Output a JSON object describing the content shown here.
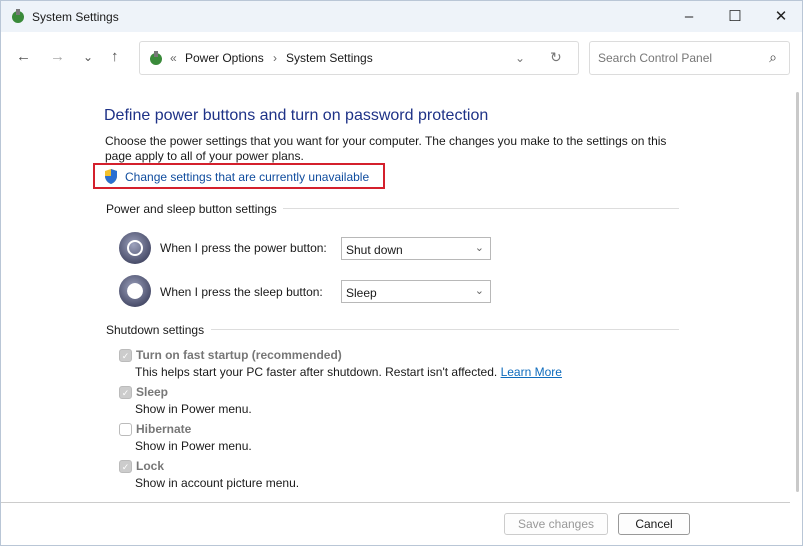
{
  "window": {
    "title": "System Settings",
    "minimize": "–",
    "maximize": "☐",
    "close": "✕"
  },
  "nav": {
    "back": "←",
    "forward": "→",
    "recent": "⌄",
    "up": "↑"
  },
  "address": {
    "prefix": "«",
    "crumbs": [
      "Power Options",
      "System Settings"
    ],
    "sep": "›",
    "dropdown": "⌄",
    "refresh": "↻"
  },
  "search": {
    "placeholder": "Search Control Panel",
    "icon": "⌕"
  },
  "page": {
    "heading": "Define power buttons and turn on password protection",
    "description": "Choose the power settings that you want for your computer. The changes you make to the settings on this page apply to all of your power plans.",
    "change_link": "Change settings that are currently unavailable",
    "power_section": "Power and sleep button settings",
    "power_label": "When I press the power button:",
    "power_value": "Shut down",
    "sleep_label": "When I press the sleep button:",
    "sleep_value": "Sleep",
    "shutdown_section": "Shutdown settings",
    "options": [
      {
        "label": "Turn on fast startup (recommended)",
        "desc": "This helps start your PC faster after shutdown. Restart isn't affected.",
        "checked": true
      },
      {
        "label": "Sleep",
        "desc": "Show in Power menu.",
        "checked": true
      },
      {
        "label": "Hibernate",
        "desc": "Show in Power menu.",
        "checked": false
      },
      {
        "label": "Lock",
        "desc": "Show in account picture menu.",
        "checked": true
      }
    ],
    "learn_more": "Learn More",
    "save": "Save changes",
    "cancel": "Cancel"
  }
}
